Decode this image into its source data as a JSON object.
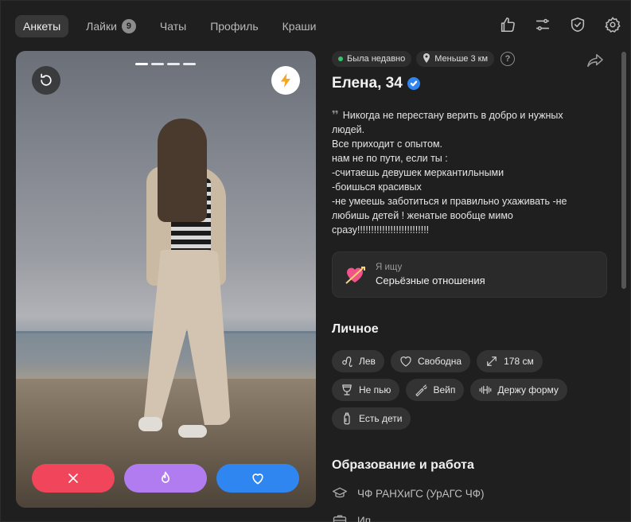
{
  "tabs": [
    {
      "label": "Анкеты",
      "active": true
    },
    {
      "label": "Лайки",
      "badge": "9"
    },
    {
      "label": "Чаты"
    },
    {
      "label": "Профиль"
    },
    {
      "label": "Краши"
    }
  ],
  "toolbar_icons": [
    "thumbs-up-icon",
    "sliders-icon",
    "shield-check-icon",
    "gear-icon"
  ],
  "photo": {
    "pager_count": 4,
    "undo_icon": "undo-icon",
    "boost_icon": "lightning-icon"
  },
  "actions": {
    "dislike_icon": "close-icon",
    "super_icon": "flame-icon",
    "like_icon": "heart-icon"
  },
  "profile": {
    "status": "Была недавно",
    "distance": "Меньше 3 км",
    "help": "?",
    "name": "Елена, 34",
    "bio_quote": "❜❜",
    "bio": "Никогда не перестану верить в добро и нужных людей.\nВсе приходит с опытом.\nнам не по пути, если ты :\n-считаешь девушек меркантильными\n-боишься красивых\n-не умеешь заботиться и правильно ухаживать -не любишь детей ! женатые вообще мимо сразу!!!!!!!!!!!!!!!!!!!!!!!!!!"
  },
  "seeking": {
    "label": "Я ищу",
    "value": "Серьёзные отношения"
  },
  "personal": {
    "title": "Личное",
    "tags": [
      {
        "label": "Лев",
        "icon": "leo-icon"
      },
      {
        "label": "Свободна",
        "icon": "heart-outline-icon"
      },
      {
        "label": "178 см",
        "icon": "height-arrows-icon"
      },
      {
        "label": "Не пью",
        "icon": "glass-icon"
      },
      {
        "label": "Вейп",
        "icon": "vape-icon"
      },
      {
        "label": "Держу форму",
        "icon": "dumbbell-icon"
      },
      {
        "label": "Есть дети",
        "icon": "baby-bottle-icon"
      }
    ]
  },
  "education": {
    "title": "Образование и работа",
    "items": [
      {
        "label": "ЧФ РАНХиГС (УрАГС ЧФ)",
        "icon": "graduation-cap-icon"
      },
      {
        "label": "Ип",
        "icon": "briefcase-icon"
      }
    ]
  },
  "colors": {
    "background": "#1f1f1f",
    "dislike": "#f0455a",
    "super": "#b07cf0",
    "like": "#2f86f0",
    "online": "#35c46a",
    "boost": "#f5a623"
  }
}
